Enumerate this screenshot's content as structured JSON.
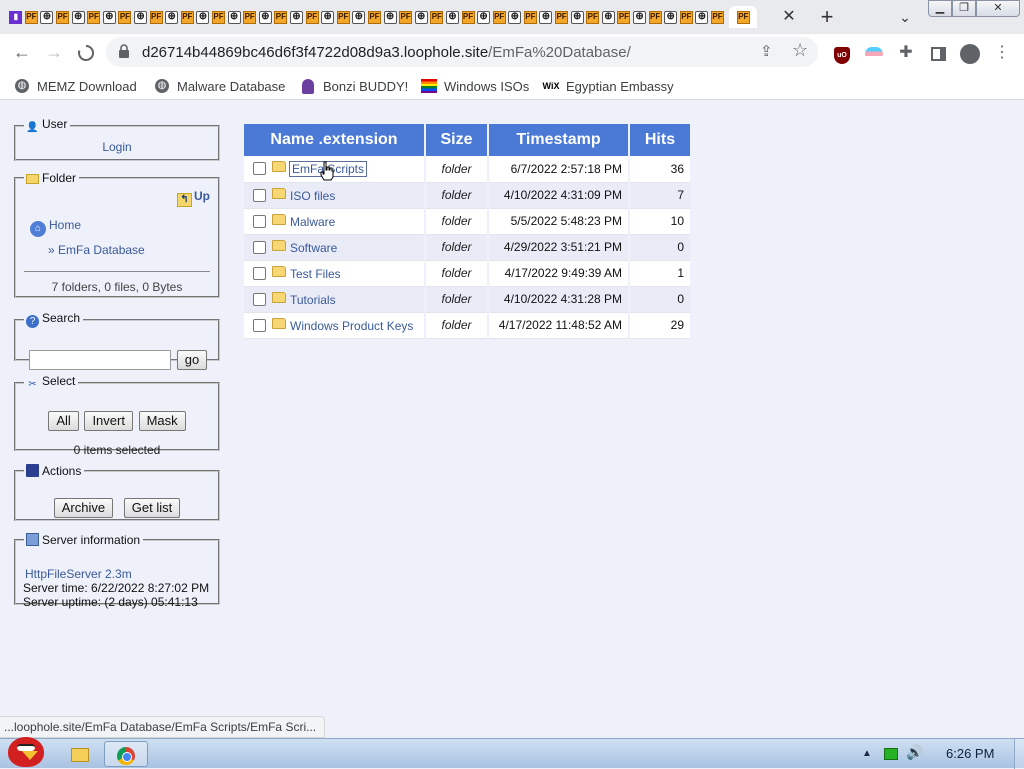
{
  "browser": {
    "tabs": [
      {
        "icon": "twitch-icon"
      },
      {
        "icon": "pf-icon"
      },
      {
        "icon": "globe-icon"
      },
      {
        "icon": "pf-icon"
      },
      {
        "icon": "globe-icon"
      },
      {
        "icon": "pf-icon"
      },
      {
        "icon": "globe-icon"
      },
      {
        "icon": "pf-icon"
      },
      {
        "icon": "globe-icon"
      },
      {
        "icon": "pf-icon"
      },
      {
        "icon": "globe-icon"
      },
      {
        "icon": "pf-icon"
      },
      {
        "icon": "globe-icon"
      },
      {
        "icon": "pf-icon"
      },
      {
        "icon": "globe-icon"
      },
      {
        "icon": "pf-icon"
      },
      {
        "icon": "globe-icon"
      },
      {
        "icon": "pf-icon"
      },
      {
        "icon": "globe-icon"
      },
      {
        "icon": "pf-icon"
      },
      {
        "icon": "globe-icon"
      },
      {
        "icon": "pf-icon"
      },
      {
        "icon": "globe-icon"
      },
      {
        "icon": "pf-icon"
      },
      {
        "icon": "globe-icon"
      },
      {
        "icon": "pf-icon"
      },
      {
        "icon": "globe-icon"
      },
      {
        "icon": "pf-icon"
      },
      {
        "icon": "globe-icon"
      },
      {
        "icon": "pf-icon"
      },
      {
        "icon": "globe-icon"
      },
      {
        "icon": "pf-icon"
      },
      {
        "icon": "globe-icon"
      },
      {
        "icon": "pf-icon"
      },
      {
        "icon": "globe-icon"
      },
      {
        "icon": "pf-icon"
      },
      {
        "icon": "globe-icon"
      },
      {
        "icon": "pf-icon"
      },
      {
        "icon": "globe-icon"
      },
      {
        "icon": "pf-icon"
      },
      {
        "icon": "globe-icon"
      },
      {
        "icon": "pf-icon"
      },
      {
        "icon": "globe-icon"
      },
      {
        "icon": "pf-icon"
      },
      {
        "icon": "globe-icon"
      },
      {
        "icon": "pf-icon"
      }
    ],
    "pf_label": "PF",
    "url_host": "d26714b44869bc46d6f3f4722d08d9a3.loophole.site",
    "url_path": "/EmFa%20Database/",
    "bookmarks": [
      {
        "label": "MEMZ Download",
        "icon": "globe-icon"
      },
      {
        "label": "Malware Database",
        "icon": "globe-icon"
      },
      {
        "label": "Bonzi BUDDY!",
        "icon": "bonzi-icon"
      },
      {
        "label": "Windows ISOs",
        "icon": "rainbow-flag-icon"
      },
      {
        "label": "Egyptian Embassy",
        "icon": "wix-icon"
      }
    ],
    "wix_label": "WiX",
    "ublock_label": "uO",
    "status_url": "...loophole.site/EmFa Database/EmFa Scripts/EmFa Scri..."
  },
  "sidebar": {
    "user": {
      "title": "User",
      "login": "Login"
    },
    "folder": {
      "title": "Folder",
      "up": "Up",
      "home": "Home",
      "crumb": "» EmFa Database",
      "stats": "7 folders, 0 files, 0 Bytes"
    },
    "search": {
      "title": "Search",
      "placeholder": "",
      "go": "go"
    },
    "select": {
      "title": "Select",
      "buttons": [
        "All",
        "Invert",
        "Mask"
      ],
      "status": "0 items selected"
    },
    "actions": {
      "title": "Actions",
      "buttons": [
        "Archive",
        "Get list"
      ]
    },
    "server": {
      "title": "Server information",
      "software": "HttpFileServer 2.3m",
      "time": "Server time: 6/22/2022 8:27:02 PM",
      "uptime": "Server uptime: (2 days) 05:41:13"
    }
  },
  "table": {
    "headers": [
      "Name .extension",
      "Size",
      "Timestamp",
      "Hits"
    ],
    "rows": [
      {
        "name": "EmFa Scripts",
        "size": "folder",
        "timestamp": "6/7/2022 2:57:18 PM",
        "hits": "36"
      },
      {
        "name": "ISO files",
        "size": "folder",
        "timestamp": "4/10/2022 4:31:09 PM",
        "hits": "7"
      },
      {
        "name": "Malware",
        "size": "folder",
        "timestamp": "5/5/2022 5:48:23 PM",
        "hits": "10"
      },
      {
        "name": "Software",
        "size": "folder",
        "timestamp": "4/29/2022 3:51:21 PM",
        "hits": "0"
      },
      {
        "name": "Test Files",
        "size": "folder",
        "timestamp": "4/17/2022 9:49:39 AM",
        "hits": "1"
      },
      {
        "name": "Tutorials",
        "size": "folder",
        "timestamp": "4/10/2022 4:31:28 PM",
        "hits": "0"
      },
      {
        "name": "Windows Product Keys",
        "size": "folder",
        "timestamp": "4/17/2022 11:48:52 AM",
        "hits": "29"
      }
    ]
  },
  "taskbar": {
    "apps": [
      {
        "name": "file-explorer"
      },
      {
        "name": "google-chrome"
      }
    ],
    "clock": "6:26 PM"
  },
  "colors": {
    "table_header": "#4a79d6",
    "link": "#3b5a9a",
    "page_bg": "#eef0fa"
  }
}
